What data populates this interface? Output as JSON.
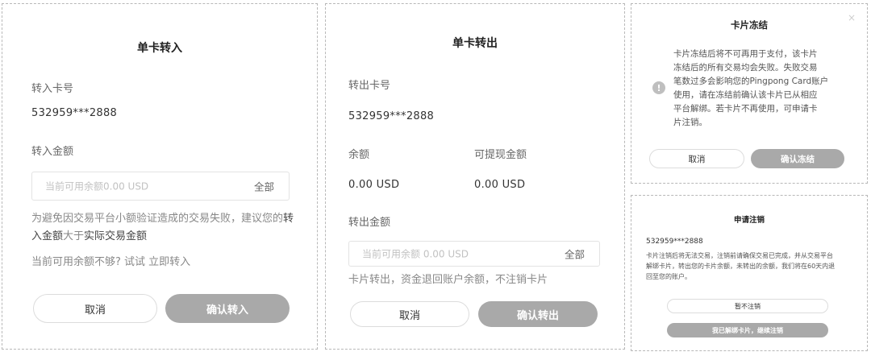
{
  "transfer_in": {
    "title": "单卡转入",
    "card_label": "转入卡号",
    "card_number": "532959***2888",
    "amount_label": "转入金额",
    "amount_placeholder": "当前可用余额0.00 USD",
    "all_label": "全部",
    "tip_part1": "为避免因交易平台小额验证造成的交易失败，建议您的",
    "tip_bold1": "转入金额",
    "tip_part2": "大于",
    "tip_bold2": "实际交易金额",
    "insufficient_text": "当前可用余额不够? 试试 ",
    "insufficient_link": "立即转入",
    "cancel_label": "取消",
    "confirm_label": "确认转入"
  },
  "transfer_out": {
    "title": "单卡转出",
    "card_label": "转出卡号",
    "card_number": "532959***2888",
    "balance_label": "余额",
    "balance_value": "0.00 USD",
    "withdrawable_label": "可提现金额",
    "withdrawable_value": "0.00 USD",
    "amount_label": "转出金额",
    "amount_placeholder": "当前可用余额 0.00 USD",
    "all_label": "全部",
    "tip": "卡片转出，资金退回账户余额，不注销卡片",
    "cancel_label": "取消",
    "confirm_label": "确认转出"
  },
  "freeze": {
    "title": "卡片冻结",
    "close_icon": "×",
    "warn_icon": "!",
    "lines": [
      "卡片冻结后将不可再用于支付，该卡片",
      "冻结后的所有交易均会失败。失败交易",
      "笔数过多会影响您的Pingpong Card账户",
      "使用，请在冻结前确认该卡片已从相应",
      "平台解绑。若卡片不再使用，可申请卡",
      "片注销。"
    ],
    "cancel_label": "取消",
    "confirm_label": "确认冻结"
  },
  "cancel_card": {
    "title": "申请注销",
    "card_number": "532959***2888",
    "lines": [
      "卡片注销后将无法交易，注销前请确保交易已完成，并从交易平台",
      "解绑卡片，转出您的卡片余额，未转出的余额，我们将在60天内退",
      "回至您的账户。"
    ],
    "no_cancel_label": "暂不注销",
    "confirm_label": "我已解绑卡片，继续注销"
  }
}
